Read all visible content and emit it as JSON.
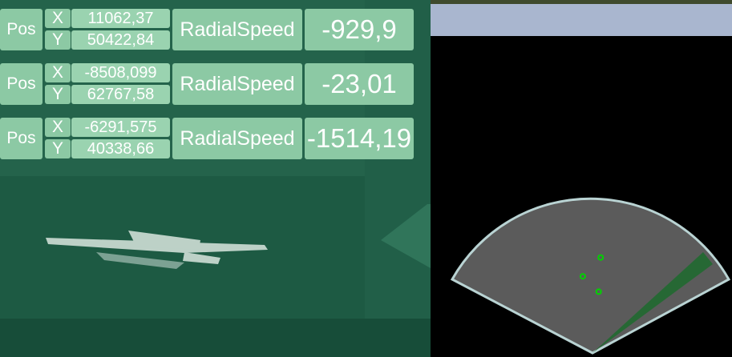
{
  "targets": [
    {
      "pos_label": "Pos",
      "x_label": "X",
      "y_label": "Y",
      "x": "11062,37",
      "y": "50422,84",
      "speed_label": "RadialSpeed",
      "speed": "-929,9"
    },
    {
      "pos_label": "Pos",
      "x_label": "X",
      "y_label": "Y",
      "x": "-8508,099",
      "y": "62767,58",
      "speed_label": "RadialSpeed",
      "speed": "-23,01"
    },
    {
      "pos_label": "Pos",
      "x_label": "X",
      "y_label": "Y",
      "x": "-6291,575",
      "y": "40338,66",
      "speed_label": "RadialSpeed",
      "speed": "-1514,19"
    }
  ],
  "radar": {
    "blip_color": "#00d400",
    "sector_fill": "#5b5b5b",
    "sector_border": "#b9d3d3",
    "sweep_color": "#1d6b2e",
    "blip_count": 3
  },
  "colors": {
    "panel_bg": "#8cc9a4",
    "scene_tint": "#1d5b44",
    "radar_header": "#a9b6cf"
  }
}
